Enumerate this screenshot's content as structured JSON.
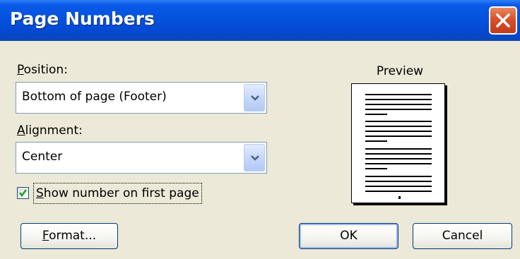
{
  "window": {
    "title": "Page Numbers"
  },
  "position": {
    "label_first": "P",
    "label_rest": "osition:",
    "value": "Bottom of page (Footer)"
  },
  "alignment": {
    "label_first": "A",
    "label_rest": "lignment:",
    "value": "Center"
  },
  "first_page": {
    "checked": true,
    "label_first": "S",
    "label_rest": "how number on first page"
  },
  "preview": {
    "label": "Preview"
  },
  "buttons": {
    "format_first": "F",
    "format_rest": "ormat...",
    "ok": "OK",
    "cancel": "Cancel"
  },
  "colors": {
    "titlebar": "#0552dc",
    "dialog_bg": "#ece9d8",
    "close_button": "#d8502c",
    "checkmark": "#21a121"
  }
}
